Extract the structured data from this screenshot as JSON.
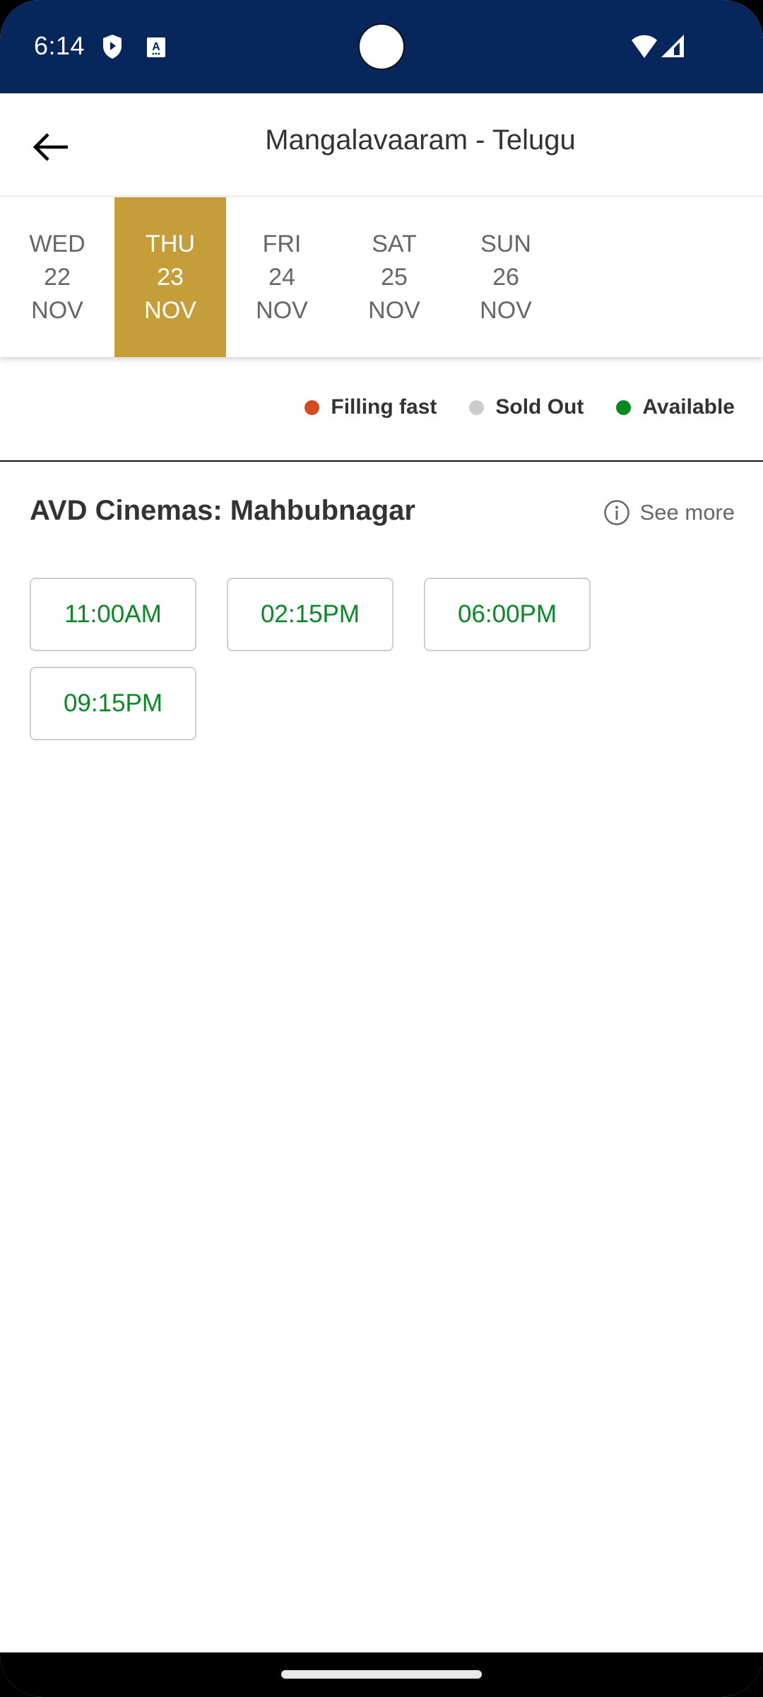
{
  "status_bar": {
    "time": "6:14",
    "left_icons": [
      "shield-play-icon",
      "accessibility-a-icon"
    ],
    "right_icons": [
      "wifi-icon",
      "cellular-signal-icon"
    ],
    "background_color": "#06265C"
  },
  "app_bar": {
    "back_icon": "arrow-left-icon",
    "title": "Mangalavaaram - Telugu"
  },
  "date_tabs": [
    {
      "day": "WED",
      "date": "22",
      "month": "NOV",
      "selected": false
    },
    {
      "day": "THU",
      "date": "23",
      "month": "NOV",
      "selected": true
    },
    {
      "day": "FRI",
      "date": "24",
      "month": "NOV",
      "selected": false
    },
    {
      "day": "SAT",
      "date": "25",
      "month": "NOV",
      "selected": false
    },
    {
      "day": "SUN",
      "date": "26",
      "month": "NOV",
      "selected": false
    }
  ],
  "selected_tab_color": "#C59E3A",
  "legend": [
    {
      "label": "Filling fast",
      "color": "#D64A1E"
    },
    {
      "label": "Sold Out",
      "color": "#CCCCCC"
    },
    {
      "label": "Available",
      "color": "#068A24"
    }
  ],
  "cinema": {
    "name": "AVD Cinemas: Mahbubnagar",
    "see_more_icon": "info-icon",
    "see_more_label": "See more",
    "showtimes": [
      {
        "time": "11:00AM",
        "status": "Available"
      },
      {
        "time": "02:15PM",
        "status": "Available"
      },
      {
        "time": "06:00PM",
        "status": "Available"
      },
      {
        "time": "09:15PM",
        "status": "Available"
      }
    ]
  },
  "nav_bar": {
    "home_handle": "gesture-home-handle"
  }
}
